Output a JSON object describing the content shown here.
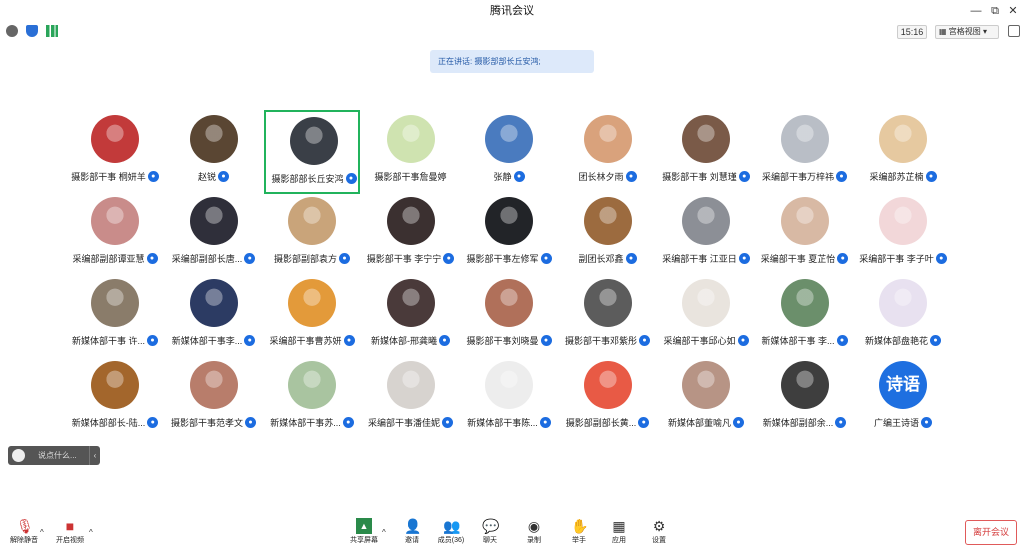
{
  "window": {
    "title": "腾讯会议",
    "controls": {
      "minimize": "—",
      "restore": "⧉",
      "close": "✕"
    }
  },
  "topbar": {
    "time": "15:16",
    "view_mode": "宫格视图",
    "view_caret": "▾",
    "icons": [
      "info-icon",
      "shield-icon",
      "signal-icon"
    ]
  },
  "speaking_banner": "正在讲话: 摄影部部长丘安鸿;",
  "participants": [
    {
      "name": "摄影部干事 桐妍羊",
      "color": "#c23a3a"
    },
    {
      "name": "赵锐",
      "color": "#5a4633"
    },
    {
      "name": "摄影部部长丘安鸿",
      "color": "#3a3f47",
      "active": true
    },
    {
      "name": "摄影部干事詹曼婷",
      "color": "#cfe3b0",
      "no_mic": true
    },
    {
      "name": "张静",
      "color": "#4a7bbf"
    },
    {
      "name": "团长林夕雨",
      "color": "#d9a27c"
    },
    {
      "name": "摄影部干事 刘慧瑾",
      "color": "#7a5a48"
    },
    {
      "name": "采编部干事万梓祎",
      "color": "#b9bec6"
    },
    {
      "name": "采编部苏芷楠",
      "color": "#e6c9a0"
    },
    {
      "name": "采编部副部谭亚慧",
      "color": "#c98c8a"
    },
    {
      "name": "采编部副部长唐...",
      "color": "#2f2f3a"
    },
    {
      "name": "摄影部副部袁方",
      "color": "#c9a47a"
    },
    {
      "name": "摄影部干事 李宁宁",
      "color": "#3b3030"
    },
    {
      "name": "摄影部干事左修军",
      "color": "#222428"
    },
    {
      "name": "副团长邓鑫",
      "color": "#9c6b3f"
    },
    {
      "name": "采编部干事 江亚日",
      "color": "#8c8f96"
    },
    {
      "name": "采编部干事 夏芷怡",
      "color": "#d8b9a4"
    },
    {
      "name": "采编部干事 李子叶",
      "color": "#f2d7d9"
    },
    {
      "name": "新媒体部干事 许...",
      "color": "#8a7c6a"
    },
    {
      "name": "新媒体部干事李...",
      "color": "#2c3b63"
    },
    {
      "name": "采编部干事曹苏妍",
      "color": "#e39a3a"
    },
    {
      "name": "新媒体部-邢龚曦",
      "color": "#4a3a3a"
    },
    {
      "name": "摄影部干事刘晓曼",
      "color": "#b0705a"
    },
    {
      "name": "摄影部干事邓紫彤",
      "color": "#5c5c5c"
    },
    {
      "name": "采编部干事邱心如",
      "color": "#e9e4de"
    },
    {
      "name": "新媒体部干事 李...",
      "color": "#6b8f6b"
    },
    {
      "name": "新媒体部盘艳花",
      "color": "#e8e1f0"
    },
    {
      "name": "新媒体部部长-陆...",
      "color": "#a3662c"
    },
    {
      "name": "摄影部干事范孝文",
      "color": "#b87d6b"
    },
    {
      "name": "新媒体部干事苏...",
      "color": "#a9c4a0"
    },
    {
      "name": "采编部干事潘佳妮",
      "color": "#d7d3cf"
    },
    {
      "name": "新媒体部干事陈...",
      "color": "#ededed"
    },
    {
      "name": "摄影部副部长黄...",
      "color": "#e85a45"
    },
    {
      "name": "新媒体部董喻凡",
      "color": "#b79485"
    },
    {
      "name": "新媒体部副部余...",
      "color": "#3e3e3e"
    },
    {
      "name": "广编王诗语",
      "avatar_text": "诗语",
      "color": "#1e6fe0"
    }
  ],
  "chat": {
    "placeholder": "说点什么...",
    "collapse": "‹"
  },
  "toolbar": {
    "unmute": "解除静音",
    "video": "开启视频",
    "share": "共享屏幕",
    "invite": "邀请",
    "members": "成员(36)",
    "chat": "聊天",
    "record": "录制",
    "raise_hand": "举手",
    "apps": "应用",
    "settings": "设置",
    "caret": "^"
  },
  "leave_button": "离开会议",
  "colors": {
    "accent": "#1e6fe0",
    "active_border": "#21b35c",
    "leave": "#d43c3c"
  }
}
